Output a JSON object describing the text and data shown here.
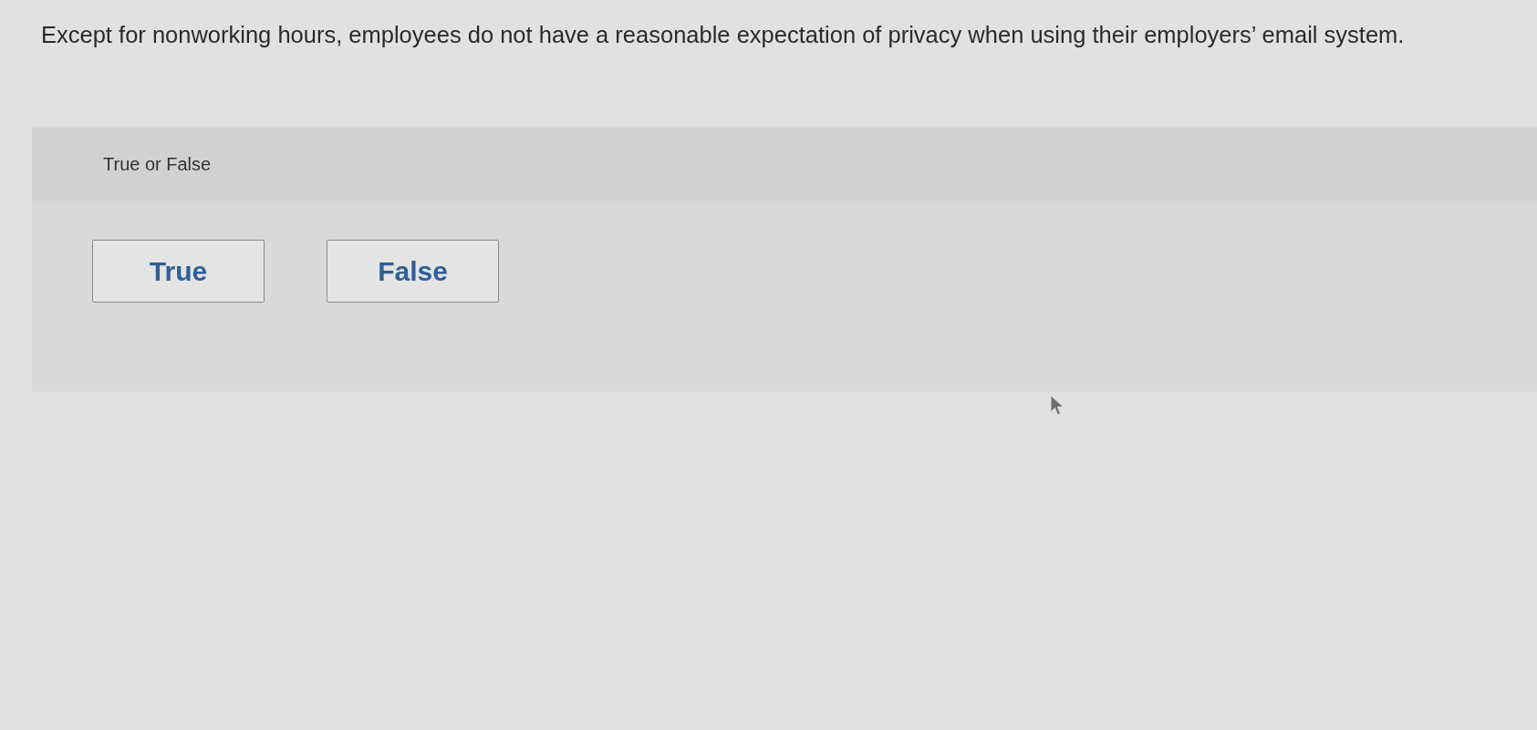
{
  "question": "Except for nonworking hours, employees do not have a reasonable expectation of privacy when using their employers’ email system.",
  "answer_panel": {
    "prompt": "True or False",
    "options": [
      {
        "label": "True",
        "selected": false
      },
      {
        "label": "False",
        "selected": false
      }
    ]
  }
}
